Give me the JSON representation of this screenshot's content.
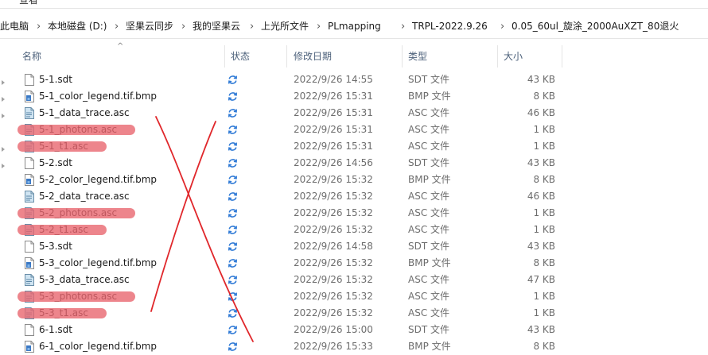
{
  "ribbon": {
    "tab_view": "查看"
  },
  "breadcrumb": {
    "items": [
      "此电脑",
      "本地磁盘 (D:)",
      "坚果云同步",
      "我的坚果云",
      "上光所文件",
      "PLmapping",
      "TRPL-2022.9.26",
      "0.05_60ul_旋涂_2000AuXZT_80退火"
    ],
    "separator": "›"
  },
  "columns": {
    "name": "名称",
    "status": "状态",
    "date": "修改日期",
    "type": "类型",
    "size": "大小"
  },
  "sort": {
    "column": "name",
    "indicator": "^"
  },
  "files": [
    {
      "name": "5-1.sdt",
      "date": "2022/9/26 14:55",
      "type": "SDT 文件",
      "size": "43 KB",
      "icon": "generic-file-icon",
      "highlighted": false
    },
    {
      "name": "5-1_color_legend.tif.bmp",
      "date": "2022/9/26 15:31",
      "type": "BMP 文件",
      "size": "8 KB",
      "icon": "bitmap-file-icon",
      "highlighted": false
    },
    {
      "name": "5-1_data_trace.asc",
      "date": "2022/9/26 15:31",
      "type": "ASC 文件",
      "size": "46 KB",
      "icon": "asc-file-icon",
      "highlighted": false
    },
    {
      "name": "5-1_photons.asc",
      "date": "2022/9/26 15:31",
      "type": "ASC 文件",
      "size": "1 KB",
      "icon": "asc-file-icon",
      "highlighted": true
    },
    {
      "name": "5-1_t1.asc",
      "date": "2022/9/26 15:31",
      "type": "ASC 文件",
      "size": "1 KB",
      "icon": "asc-file-icon",
      "highlighted": true
    },
    {
      "name": "5-2.sdt",
      "date": "2022/9/26 14:56",
      "type": "SDT 文件",
      "size": "43 KB",
      "icon": "generic-file-icon",
      "highlighted": false
    },
    {
      "name": "5-2_color_legend.tif.bmp",
      "date": "2022/9/26 15:32",
      "type": "BMP 文件",
      "size": "8 KB",
      "icon": "bitmap-file-icon",
      "highlighted": false
    },
    {
      "name": "5-2_data_trace.asc",
      "date": "2022/9/26 15:32",
      "type": "ASC 文件",
      "size": "46 KB",
      "icon": "asc-file-icon",
      "highlighted": false
    },
    {
      "name": "5-2_photons.asc",
      "date": "2022/9/26 15:32",
      "type": "ASC 文件",
      "size": "1 KB",
      "icon": "asc-file-icon",
      "highlighted": true
    },
    {
      "name": "5-2_t1.asc",
      "date": "2022/9/26 15:32",
      "type": "ASC 文件",
      "size": "1 KB",
      "icon": "asc-file-icon",
      "highlighted": true
    },
    {
      "name": "5-3.sdt",
      "date": "2022/9/26 14:58",
      "type": "SDT 文件",
      "size": "43 KB",
      "icon": "generic-file-icon",
      "highlighted": false
    },
    {
      "name": "5-3_color_legend.tif.bmp",
      "date": "2022/9/26 15:32",
      "type": "BMP 文件",
      "size": "8 KB",
      "icon": "bitmap-file-icon",
      "highlighted": false
    },
    {
      "name": "5-3_data_trace.asc",
      "date": "2022/9/26 15:32",
      "type": "ASC 文件",
      "size": "47 KB",
      "icon": "asc-file-icon",
      "highlighted": false
    },
    {
      "name": "5-3_photons.asc",
      "date": "2022/9/26 15:32",
      "type": "ASC 文件",
      "size": "1 KB",
      "icon": "asc-file-icon",
      "highlighted": true
    },
    {
      "name": "5-3_t1.asc",
      "date": "2022/9/26 15:32",
      "type": "ASC 文件",
      "size": "1 KB",
      "icon": "asc-file-icon",
      "highlighted": true
    },
    {
      "name": "6-1.sdt",
      "date": "2022/9/26 15:00",
      "type": "SDT 文件",
      "size": "43 KB",
      "icon": "generic-file-icon",
      "highlighted": false
    },
    {
      "name": "6-1_color_legend.tif.bmp",
      "date": "2022/9/26 15:33",
      "type": "BMP 文件",
      "size": "8 KB",
      "icon": "bitmap-file-icon",
      "highlighted": false
    }
  ],
  "colors": {
    "highlight": "#e8666f",
    "cross_out": "#e0272b",
    "sync": "#2f7ad6",
    "header_text": "#4c607a"
  },
  "status_icon": "sync-icon"
}
